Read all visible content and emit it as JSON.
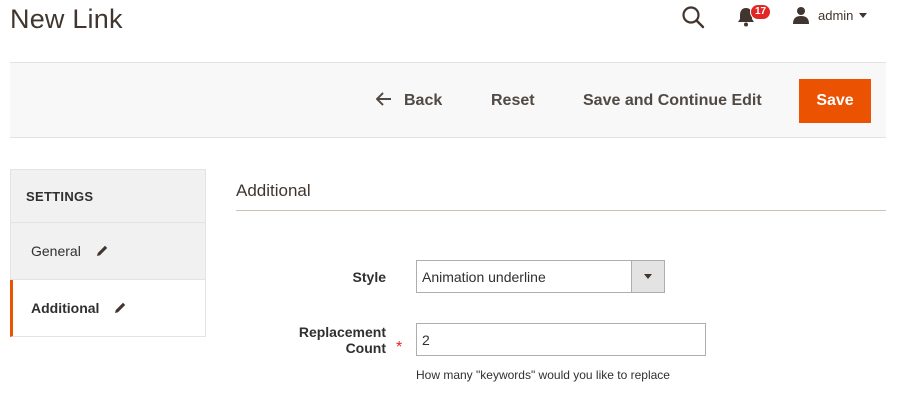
{
  "page": {
    "title": "New Link"
  },
  "header": {
    "notifications_count": "17",
    "user_name": "admin"
  },
  "toolbar": {
    "back_label": "Back",
    "reset_label": "Reset",
    "save_continue_label": "Save and Continue Edit",
    "save_label": "Save"
  },
  "sidebar": {
    "heading": "SETTINGS",
    "items": [
      {
        "label": "General",
        "active": false
      },
      {
        "label": "Additional",
        "active": true
      }
    ]
  },
  "section": {
    "title": "Additional"
  },
  "form": {
    "style": {
      "label": "Style",
      "value": "Animation underline"
    },
    "replacement_count": {
      "label_line1": "Replacement",
      "label_line2": "Count",
      "required_mark": "*",
      "value": "2",
      "note": "How many \"keywords\" would you like to replace"
    }
  },
  "colors": {
    "accent": "#eb5202",
    "badge": "#e22626"
  },
  "icons": [
    "search-icon",
    "bell-icon",
    "user-icon",
    "back-arrow-icon",
    "pencil-icon",
    "chevron-down-icon"
  ]
}
